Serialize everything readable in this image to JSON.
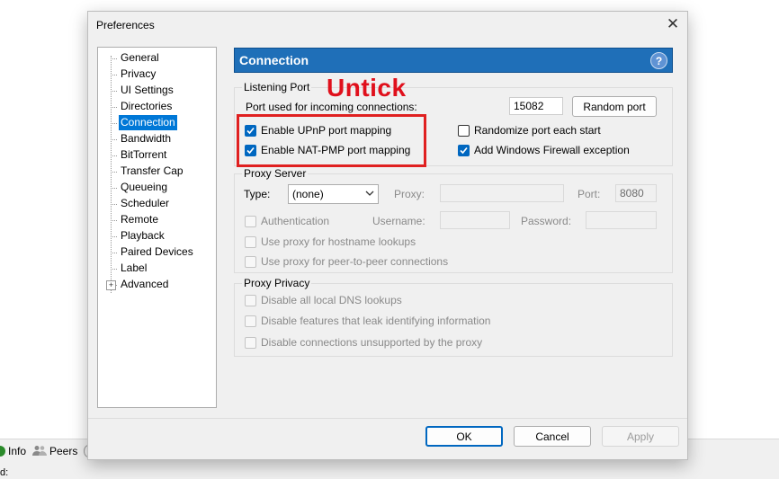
{
  "background": {
    "tabs": [
      {
        "label": "Info",
        "icon": "info-icon"
      },
      {
        "label": "Peers",
        "icon": "peers-icon"
      }
    ],
    "status_prefix": "d:"
  },
  "dialog": {
    "title": "Preferences",
    "close_glyph": "✕"
  },
  "tree": {
    "items": [
      "General",
      "Privacy",
      "UI Settings",
      "Directories",
      "Connection",
      "Bandwidth",
      "BitTorrent",
      "Transfer Cap",
      "Queueing",
      "Scheduler",
      "Remote",
      "Playback",
      "Paired Devices",
      "Label",
      "Advanced"
    ],
    "selected": "Connection",
    "expander_glyph": "+"
  },
  "header": {
    "title": "Connection",
    "help_glyph": "?",
    "color": "#1f6fb8"
  },
  "listening_port": {
    "group_label": "Listening Port",
    "port_label": "Port used for incoming connections:",
    "port_value": "15082",
    "random_port_button": "Random port",
    "upnp_label": "Enable UPnP port mapping",
    "upnp_checked": true,
    "natpmp_label": "Enable NAT-PMP port mapping",
    "natpmp_checked": true,
    "randomize_label": "Randomize port each start",
    "randomize_checked": false,
    "firewall_label": "Add Windows Firewall exception",
    "firewall_checked": true
  },
  "proxy_server": {
    "group_label": "Proxy Server",
    "type_label": "Type:",
    "type_value": "(none)",
    "proxy_label": "Proxy:",
    "proxy_value": "",
    "port_label": "Port:",
    "port_value": "8080",
    "auth_label": "Authentication",
    "username_label": "Username:",
    "password_label": "Password:",
    "hostname_lookup_label": "Use proxy for hostname lookups",
    "p2p_label": "Use proxy for peer-to-peer connections"
  },
  "proxy_privacy": {
    "group_label": "Proxy Privacy",
    "dns_label": "Disable all local DNS lookups",
    "leak_label": "Disable features that leak identifying information",
    "unsupported_label": "Disable connections unsupported by the proxy"
  },
  "footer": {
    "ok": "OK",
    "cancel": "Cancel",
    "apply": "Apply"
  },
  "annotation": {
    "text": "Untick",
    "color": "#e02020"
  }
}
